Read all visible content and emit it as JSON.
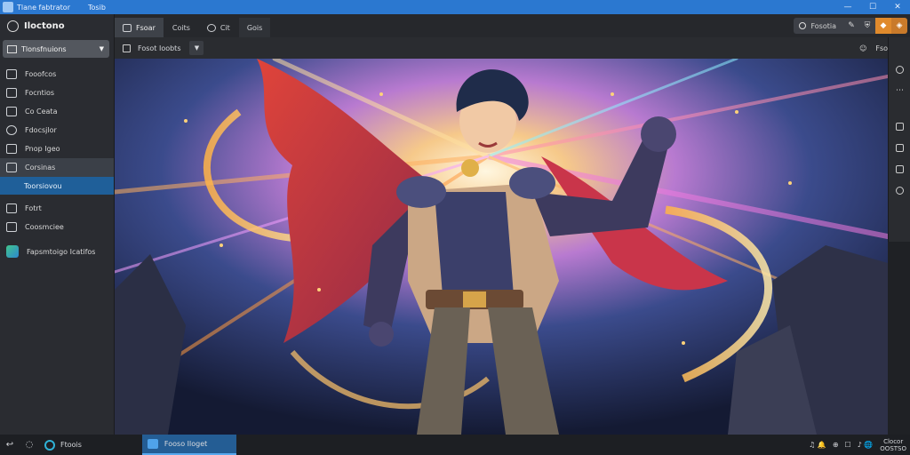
{
  "window": {
    "title_left": "Tlane fabtrator",
    "title_right": "Tosib",
    "controls": [
      "—",
      "☐",
      "✕"
    ]
  },
  "sidebar": {
    "brand": "Iloctono",
    "workspace": "Tlonsfnuions",
    "items": [
      {
        "label": "Fooofcos",
        "icon": "grid-icon"
      },
      {
        "label": "Focntios",
        "icon": "image-icon"
      },
      {
        "label": "Co Ceata",
        "icon": "columns-icon"
      },
      {
        "label": "Fdocsjlor",
        "icon": "clock-icon"
      },
      {
        "label": "Pnop Igeo",
        "icon": "brush-icon"
      },
      {
        "label": "Corsinas",
        "icon": "monitor-icon",
        "active": true
      },
      {
        "label": "Toorsiovou",
        "sub": true
      },
      {
        "label": "Fotrt",
        "icon": "layers-icon"
      },
      {
        "label": "Coosmciee",
        "icon": "wrench-icon"
      },
      {
        "label": "Fapsmtoigo Icatifos",
        "icon": "project-icon",
        "project": true
      }
    ]
  },
  "tabs": [
    {
      "label": "Fsoar",
      "active": true
    },
    {
      "label": "Coits"
    },
    {
      "label": "Cit"
    },
    {
      "label": "Gois",
      "plain": true
    }
  ],
  "tabtools": {
    "search_label": "Fosotia"
  },
  "toolbar": {
    "file_name": "Fosot Ioobts",
    "right_labels": [
      "☺",
      "Fsoi",
      "⟳"
    ]
  },
  "taskbar": {
    "start_label": "Ftoois",
    "active_window": "Fooso Iloget",
    "tray": [
      "♫ 🔔",
      "⊕",
      "☐",
      "♪ 🌐"
    ],
    "clock_line1": "Clocor",
    "clock_line2": "OOSTSO"
  },
  "colors": {
    "titlebar": "#2b78d0",
    "active_nav": "#1f5f99",
    "accent_orange": "#e08a2c",
    "background": "#1f2125"
  }
}
